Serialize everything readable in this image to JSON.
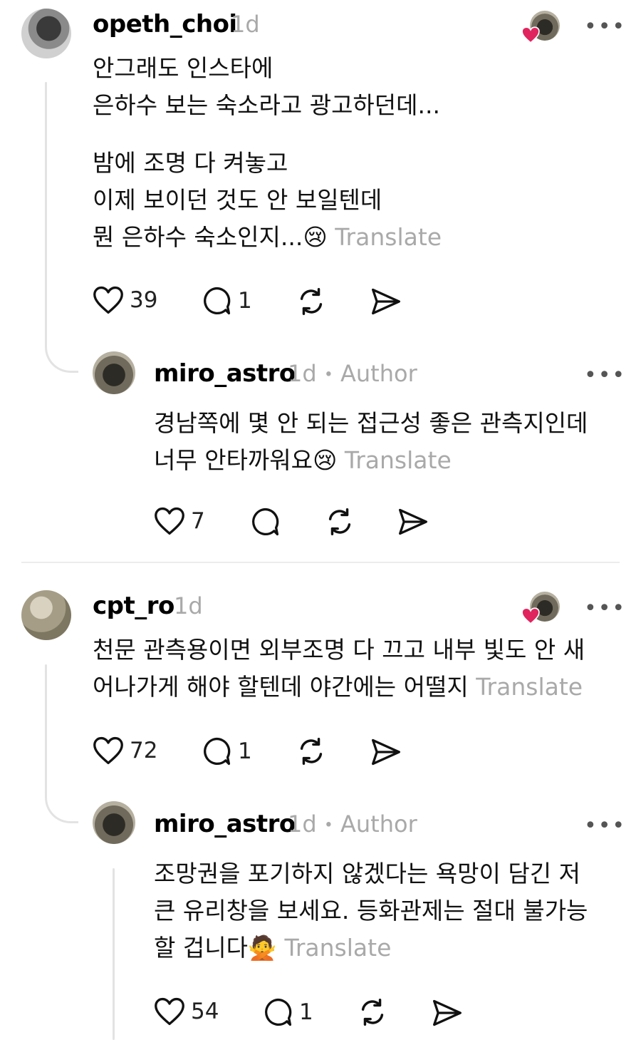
{
  "comments": [
    {
      "username": "opeth_choi",
      "time": "1d",
      "lines": [
        "안그래도 인스타에",
        "은하수 보는 숙소라고 광고하던데...",
        "밤에 조명 다 켜놓고",
        "이제 보이던 것도 안 보일텐데",
        "뭔 은하수 숙소인지...😢"
      ],
      "translate": "Translate",
      "likes": "39",
      "replies": "1",
      "reply": {
        "username": "miro_astro",
        "time": "1d",
        "author": "Author",
        "lines": [
          "경남쪽에 몇 안 되는 접근성 좋은 관측지인데",
          "너무 안타까워요😢"
        ],
        "translate": "Translate",
        "likes": "7"
      }
    },
    {
      "username": "cpt_ro",
      "time": "1d",
      "lines": [
        "천문 관측용이면 외부조명 다 끄고 내부 빛도 안 새",
        "어나가게 해야 할텐데 야간에는 어떨지"
      ],
      "translate": "Translate",
      "likes": "72",
      "replies": "1",
      "reply": {
        "username": "miro_astro",
        "time": "1d",
        "author": "Author",
        "lines": [
          "조망권을 포기하지 않겠다는 욕망이 담긴 저",
          "큰 유리창을 보세요. 등화관제는 절대 불가능",
          "할 겁니다🙅"
        ],
        "translate": "Translate",
        "likes": "54",
        "replies": "1"
      }
    }
  ],
  "menu_glyph": "•••",
  "separator": "•",
  "colors": {
    "heart": "#e0245e",
    "muted": "#a9a9a9",
    "line": "#e3e3e3"
  }
}
